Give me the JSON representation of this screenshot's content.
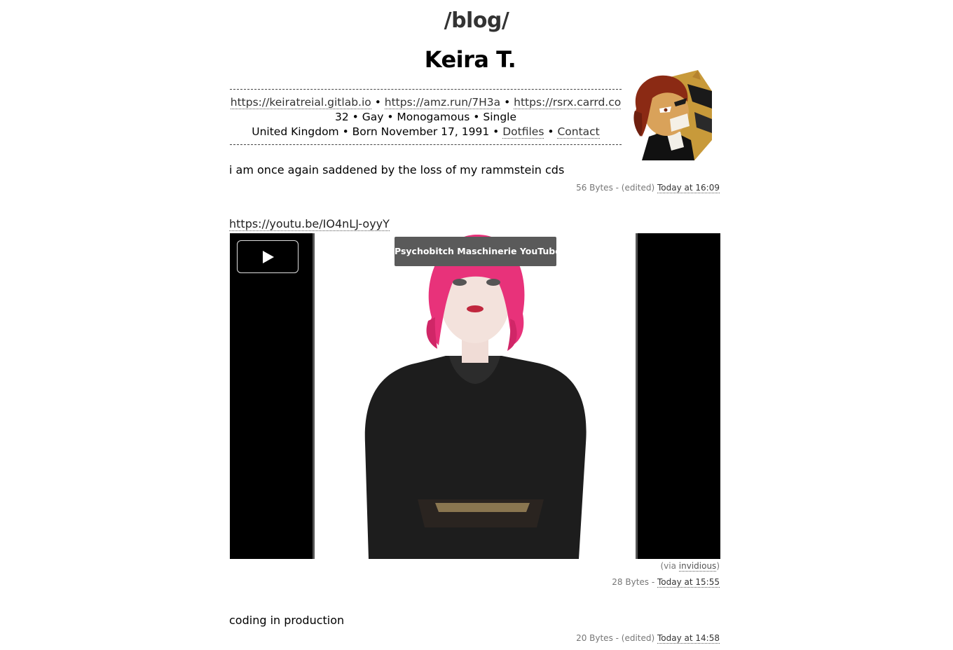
{
  "header": {
    "blog_title": "/blog/",
    "author_name": "Keira T."
  },
  "profile": {
    "links": [
      "https://keiratreial.gitlab.io",
      "https://amz.run/7H3a",
      "https://rsrx.carrd.co"
    ],
    "separator": "•",
    "info_line": "32 • Gay • Monogamous • Single",
    "location_prefix": "United Kingdom • Born November 17, 1991 •",
    "dotfiles_label": "Dotfiles",
    "contact_label": "Contact",
    "avatar_icon": "fox-character-avatar"
  },
  "posts": [
    {
      "text": "i am once again saddened by the loss of my rammstein cds",
      "meta_prefix": "56 Bytes - (edited)",
      "time_label": "Today at 16:09"
    },
    {
      "link": "https://youtu.be/IO4nLJ-oyyY",
      "video_title": "Psychobitch Maschinerie YouTube",
      "via_prefix": "(via",
      "via_link": "invidious",
      "via_suffix": ")",
      "meta_prefix": "28 Bytes -",
      "time_label": "Today at 15:55"
    },
    {
      "text": "coding in production",
      "meta_prefix": "20 Bytes - (edited)",
      "time_label": "Today at 14:58"
    }
  ],
  "colors": {
    "background": "#ffffff",
    "text": "#000000",
    "meta": "#777777",
    "video_bg": "#000000",
    "hair_accent": "#e8327a"
  }
}
